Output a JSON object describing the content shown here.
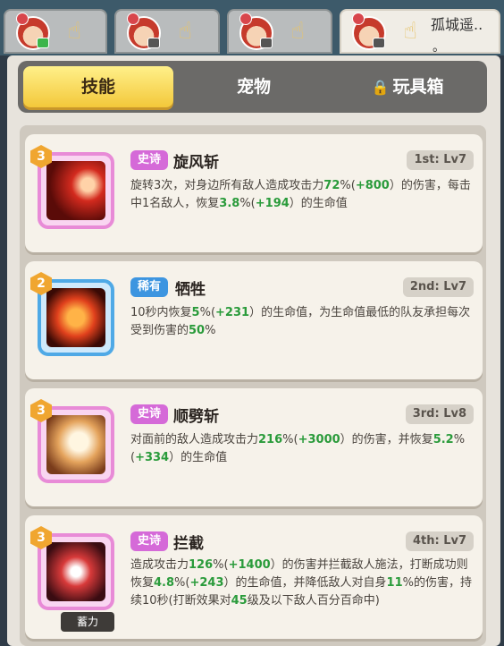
{
  "heroes": [
    {
      "sub": "green"
    },
    {
      "sub": "gray"
    },
    {
      "sub": "gray"
    },
    {
      "sub": "gray",
      "name": "孤城遥..",
      "name2": "。"
    }
  ],
  "tabs": [
    {
      "label": "技能",
      "active": true
    },
    {
      "label": "宠物",
      "active": false
    },
    {
      "label": "玩具箱",
      "active": false,
      "locked": true
    }
  ],
  "skills": [
    {
      "level": "3",
      "rarity": "史诗",
      "rarity_type": "epic",
      "name": "旋风斩",
      "slot": "1st: Lv7",
      "desc": [
        [
          "旋转3次，对身边所有敌人造成攻击力",
          ""
        ],
        [
          "72",
          "g"
        ],
        [
          "%(",
          ""
        ],
        [
          "+800",
          "g"
        ],
        [
          "）的伤害，每击中1名敌人，恢复",
          ""
        ],
        [
          "3.8",
          "g"
        ],
        [
          "%(",
          ""
        ],
        [
          "+194",
          "g"
        ],
        [
          "）的生命值",
          ""
        ]
      ]
    },
    {
      "level": "2",
      "rarity": "稀有",
      "rarity_type": "rare",
      "name": "牺牲",
      "slot": "2nd: Lv7",
      "desc": [
        [
          "10秒内恢复",
          ""
        ],
        [
          "5",
          "g"
        ],
        [
          "%(",
          ""
        ],
        [
          "+231",
          "g"
        ],
        [
          "）的生命值，为生命值最低的队友承担每次受到伤害的",
          ""
        ],
        [
          "50",
          "g"
        ],
        [
          "%",
          ""
        ]
      ]
    },
    {
      "level": "3",
      "rarity": "史诗",
      "rarity_type": "epic",
      "name": "顺劈斩",
      "slot": "3rd: Lv8",
      "desc": [
        [
          "对面前的敌人造成攻击力",
          ""
        ],
        [
          "216",
          "g"
        ],
        [
          "%(",
          ""
        ],
        [
          "+3000",
          "g"
        ],
        [
          "）的伤害，并恢复",
          ""
        ],
        [
          "5.2",
          "g"
        ],
        [
          "%(",
          ""
        ],
        [
          "+334",
          "g"
        ],
        [
          "）的生命值",
          ""
        ]
      ]
    },
    {
      "level": "3",
      "rarity": "史诗",
      "rarity_type": "epic",
      "name": "拦截",
      "slot": "4th: Lv7",
      "tag": "蓄力",
      "desc": [
        [
          "造成攻击力",
          ""
        ],
        [
          "126",
          "g"
        ],
        [
          "%(",
          ""
        ],
        [
          "+1400",
          "g"
        ],
        [
          "）的伤害并拦截敌人施法，打断成功则恢复",
          ""
        ],
        [
          "4.8",
          "g"
        ],
        [
          "%(",
          ""
        ],
        [
          "+243",
          "g"
        ],
        [
          "）的生命值，并降低敌人对自身",
          ""
        ],
        [
          "11",
          "g"
        ],
        [
          "%的伤害，持续10秒(打断效果对",
          ""
        ],
        [
          "45",
          "g"
        ],
        [
          "级及以下敌人百分百命中)",
          ""
        ]
      ]
    }
  ],
  "colors": {
    "epic": "#d56ad8",
    "rare": "#3d95e0",
    "green_value": "#2a9b3b",
    "tab_active": "#f3c83a"
  },
  "icons": {
    "hand": "pointing-hand-icon",
    "lock": "lock-icon"
  }
}
